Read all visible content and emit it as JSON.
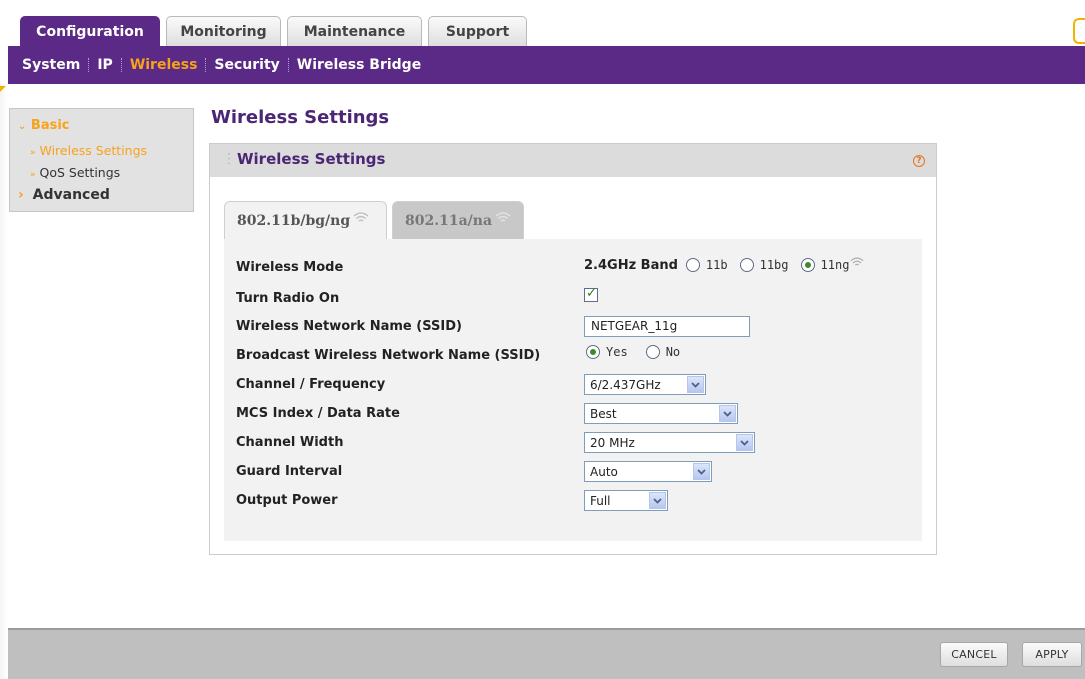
{
  "top_tabs": [
    {
      "label": "Configuration",
      "active": true
    },
    {
      "label": "Monitoring",
      "active": false
    },
    {
      "label": "Maintenance",
      "active": false
    },
    {
      "label": "Support",
      "active": false
    }
  ],
  "subnav": {
    "items": [
      "System",
      "IP",
      "Wireless",
      "Security",
      "Wireless Bridge"
    ],
    "current": "Wireless"
  },
  "sidemenu": {
    "basic": "Basic",
    "wireless_settings": "Wireless Settings",
    "qos_settings": "QoS Settings",
    "advanced": "Advanced"
  },
  "page_title": "Wireless Settings",
  "panel": {
    "title": "Wireless Settings",
    "help_icon": "help-icon"
  },
  "freq_tabs": [
    {
      "label": "802.11b/bg/ng",
      "active": true
    },
    {
      "label": "802.11a/na",
      "active": false
    }
  ],
  "form": {
    "wireless_mode": {
      "label": "Wireless Mode",
      "band": "2.4GHz Band",
      "options": [
        "11b",
        "11bg",
        "11ng"
      ],
      "selected": "11ng"
    },
    "turn_radio_on": {
      "label": "Turn Radio On",
      "checked": true
    },
    "ssid": {
      "label": "Wireless Network Name (SSID)",
      "value": "NETGEAR_11g"
    },
    "broadcast": {
      "label": "Broadcast Wireless Network Name (SSID)",
      "options": [
        "Yes",
        "No"
      ],
      "selected": "Yes"
    },
    "channel": {
      "label": "Channel / Frequency",
      "value": "6/2.437GHz"
    },
    "mcs": {
      "label": "MCS Index / Data Rate",
      "value": "Best"
    },
    "channel_width": {
      "label": "Channel Width",
      "value": "20 MHz"
    },
    "guard_interval": {
      "label": "Guard Interval",
      "value": "Auto"
    },
    "output_power": {
      "label": "Output Power",
      "value": "Full"
    }
  },
  "footer": {
    "cancel": "CANCEL",
    "apply": "APPLY"
  },
  "colors": {
    "brand_purple": "#5b2a86",
    "accent_orange": "#f7a21b",
    "footer_gray": "#bfbfbf"
  }
}
